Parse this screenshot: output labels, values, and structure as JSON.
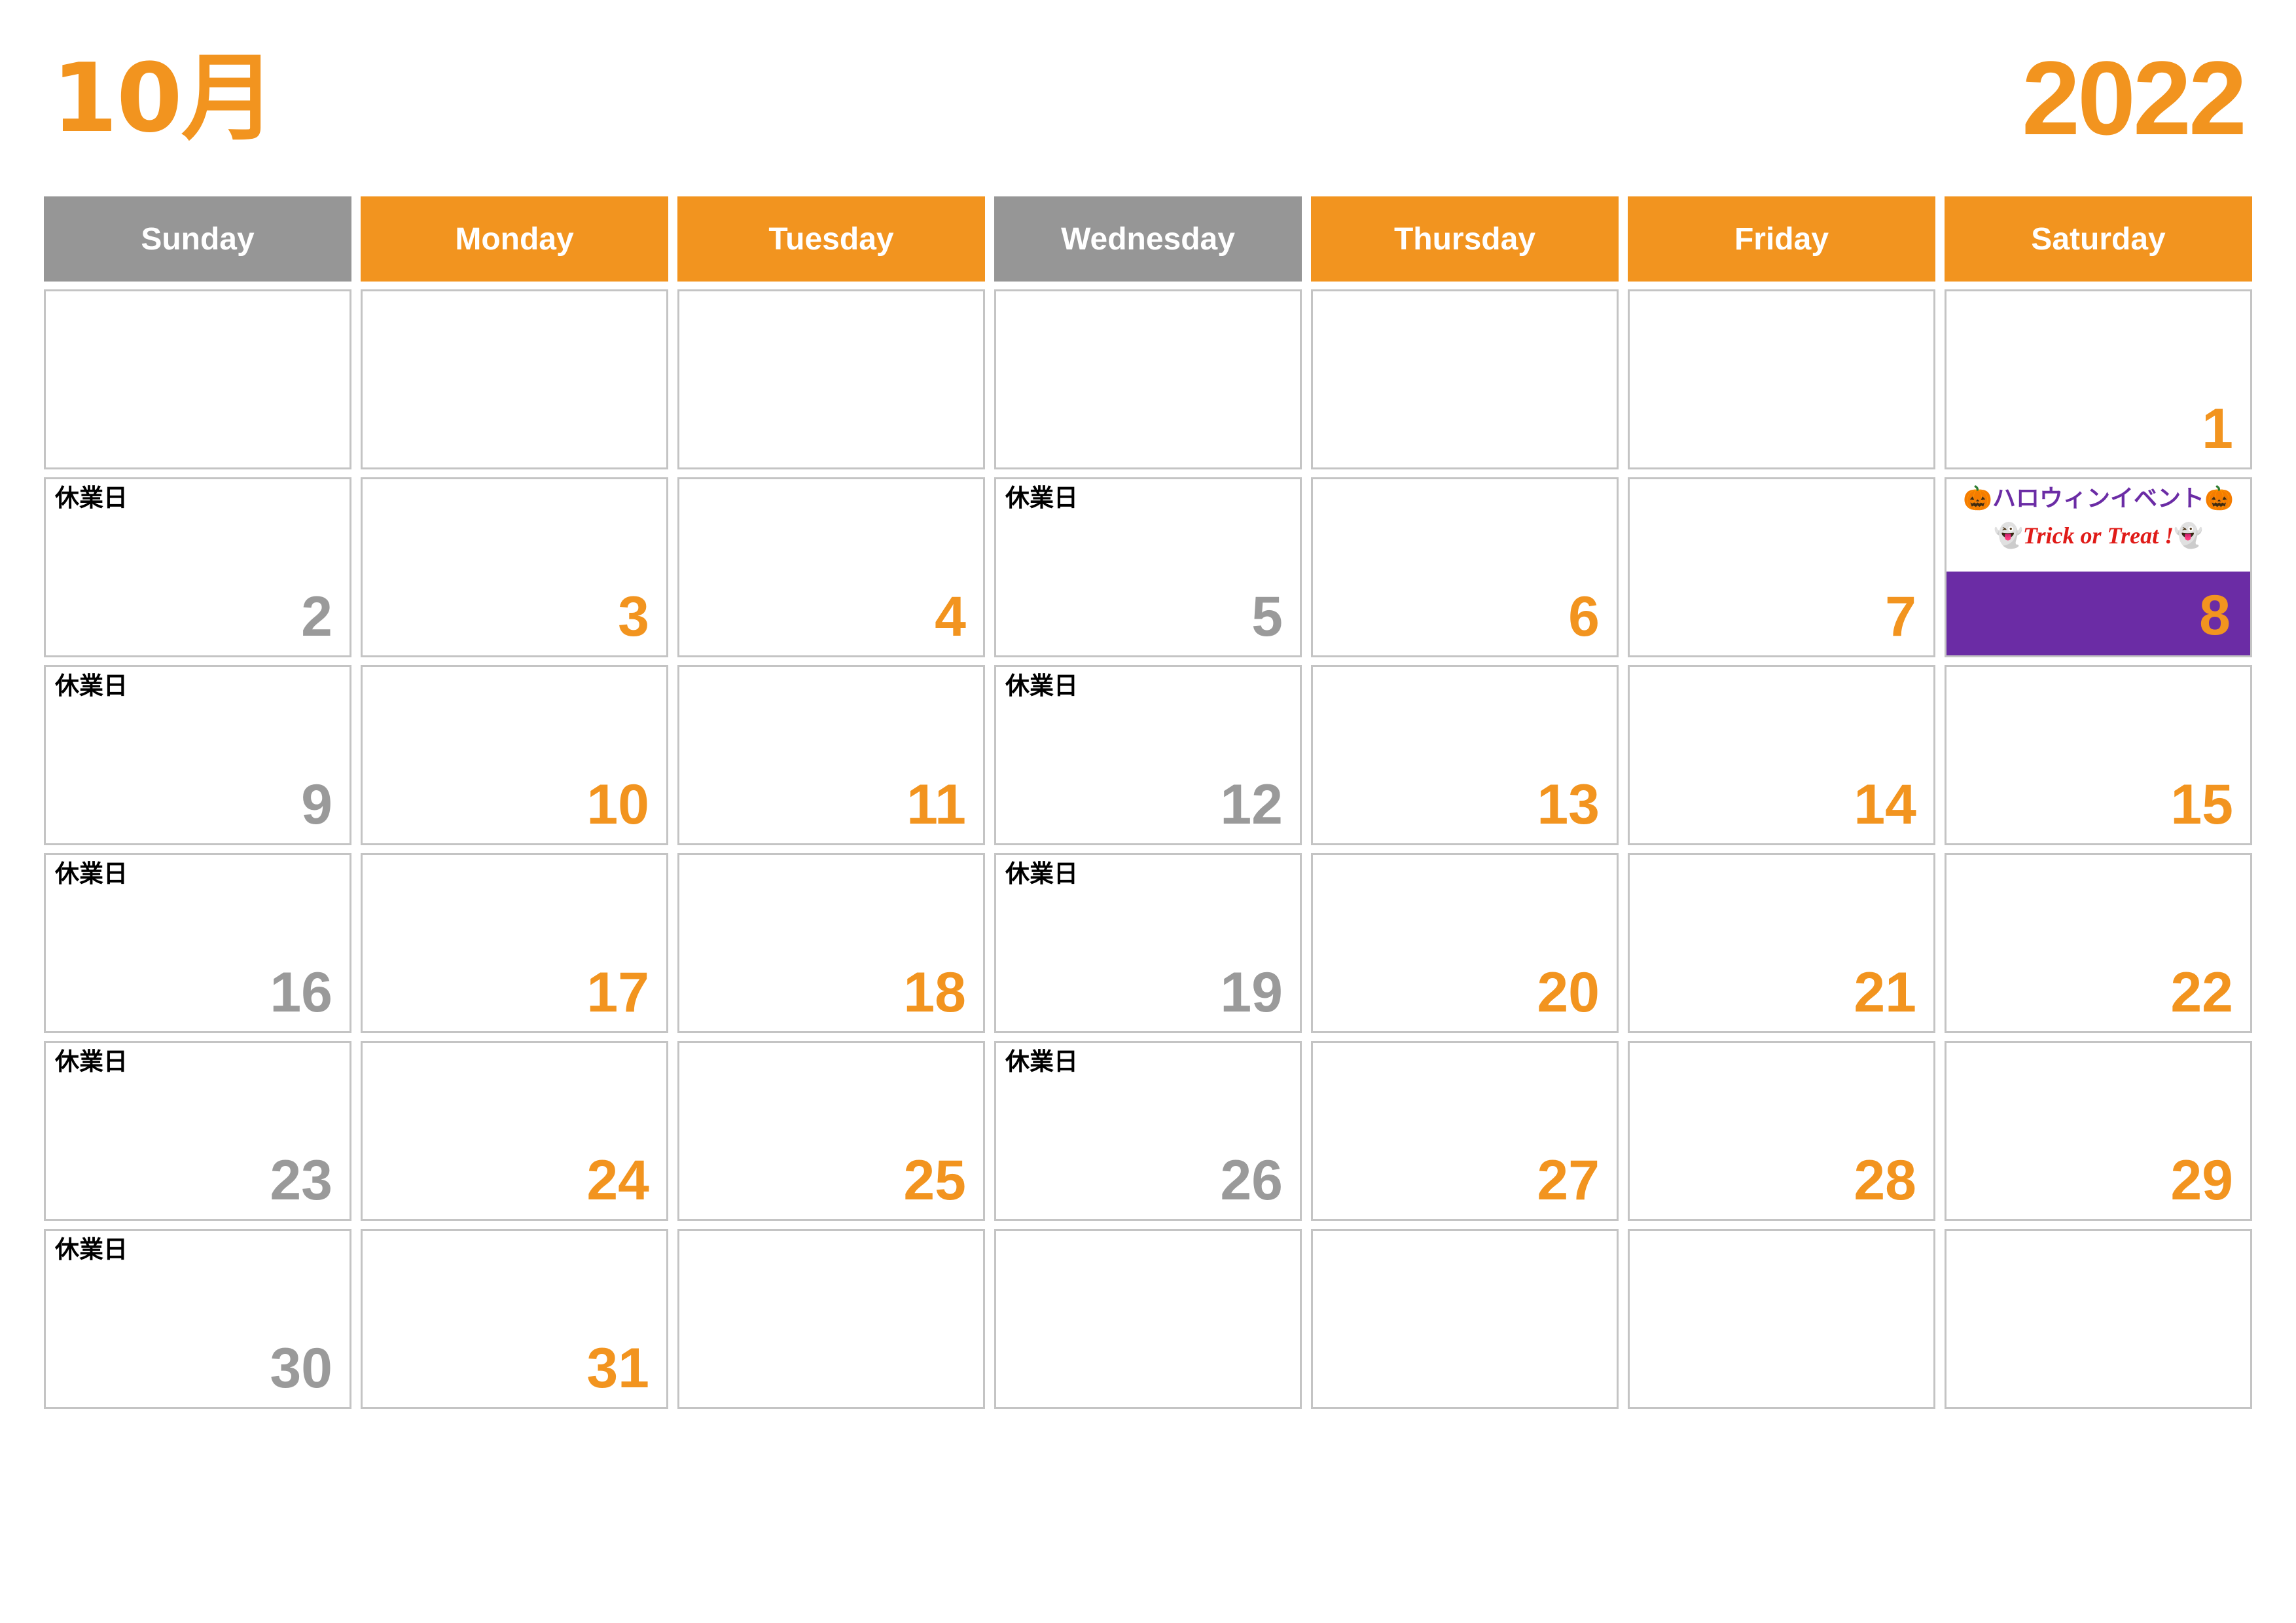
{
  "header": {
    "month_label": "10月",
    "year_label": "2022"
  },
  "colors": {
    "orange": "#F2941F",
    "gray": "#969696",
    "purple": "#6B2CA5",
    "red": "#E01B18",
    "cell_border": "#C4C4C4",
    "day_number_gray": "#9A9A9A"
  },
  "weekdays": [
    {
      "label": "Sunday",
      "style": "gray"
    },
    {
      "label": "Monday",
      "style": "orange"
    },
    {
      "label": "Tuesday",
      "style": "orange"
    },
    {
      "label": "Wednesday",
      "style": "gray"
    },
    {
      "label": "Thursday",
      "style": "orange"
    },
    {
      "label": "Friday",
      "style": "orange"
    },
    {
      "label": "Saturday",
      "style": "orange"
    }
  ],
  "labels": {
    "closed_day": "休業日"
  },
  "event": {
    "title_text": "ハロウィンイベント",
    "title_emoji_left": "🎃",
    "title_emoji_right": "🎃",
    "subtitle_text": "Trick or Treat !",
    "subtitle_emoji_left": "👻",
    "subtitle_emoji_right": "👻"
  },
  "weeks": [
    [
      {
        "day": "",
        "num_style": "",
        "closed": false
      },
      {
        "day": "",
        "num_style": "",
        "closed": false
      },
      {
        "day": "",
        "num_style": "",
        "closed": false
      },
      {
        "day": "",
        "num_style": "",
        "closed": false
      },
      {
        "day": "",
        "num_style": "",
        "closed": false
      },
      {
        "day": "",
        "num_style": "",
        "closed": false
      },
      {
        "day": "1",
        "num_style": "orange",
        "closed": false
      }
    ],
    [
      {
        "day": "2",
        "num_style": "gray",
        "closed": true
      },
      {
        "day": "3",
        "num_style": "orange",
        "closed": false
      },
      {
        "day": "4",
        "num_style": "orange",
        "closed": false
      },
      {
        "day": "5",
        "num_style": "gray",
        "closed": true
      },
      {
        "day": "6",
        "num_style": "orange",
        "closed": false
      },
      {
        "day": "7",
        "num_style": "orange",
        "closed": false
      },
      {
        "day": "8",
        "num_style": "orange",
        "closed": false,
        "event": true
      }
    ],
    [
      {
        "day": "9",
        "num_style": "gray",
        "closed": true
      },
      {
        "day": "10",
        "num_style": "orange",
        "closed": false
      },
      {
        "day": "11",
        "num_style": "orange",
        "closed": false
      },
      {
        "day": "12",
        "num_style": "gray",
        "closed": true
      },
      {
        "day": "13",
        "num_style": "orange",
        "closed": false
      },
      {
        "day": "14",
        "num_style": "orange",
        "closed": false
      },
      {
        "day": "15",
        "num_style": "orange",
        "closed": false
      }
    ],
    [
      {
        "day": "16",
        "num_style": "gray",
        "closed": true
      },
      {
        "day": "17",
        "num_style": "orange",
        "closed": false
      },
      {
        "day": "18",
        "num_style": "orange",
        "closed": false
      },
      {
        "day": "19",
        "num_style": "gray",
        "closed": true
      },
      {
        "day": "20",
        "num_style": "orange",
        "closed": false
      },
      {
        "day": "21",
        "num_style": "orange",
        "closed": false
      },
      {
        "day": "22",
        "num_style": "orange",
        "closed": false
      }
    ],
    [
      {
        "day": "23",
        "num_style": "gray",
        "closed": true
      },
      {
        "day": "24",
        "num_style": "orange",
        "closed": false
      },
      {
        "day": "25",
        "num_style": "orange",
        "closed": false
      },
      {
        "day": "26",
        "num_style": "gray",
        "closed": true
      },
      {
        "day": "27",
        "num_style": "orange",
        "closed": false
      },
      {
        "day": "28",
        "num_style": "orange",
        "closed": false
      },
      {
        "day": "29",
        "num_style": "orange",
        "closed": false
      }
    ],
    [
      {
        "day": "30",
        "num_style": "gray",
        "closed": true
      },
      {
        "day": "31",
        "num_style": "orange",
        "closed": false
      },
      {
        "day": "",
        "num_style": "",
        "closed": false
      },
      {
        "day": "",
        "num_style": "",
        "closed": false
      },
      {
        "day": "",
        "num_style": "",
        "closed": false
      },
      {
        "day": "",
        "num_style": "",
        "closed": false
      },
      {
        "day": "",
        "num_style": "",
        "closed": false
      }
    ]
  ]
}
